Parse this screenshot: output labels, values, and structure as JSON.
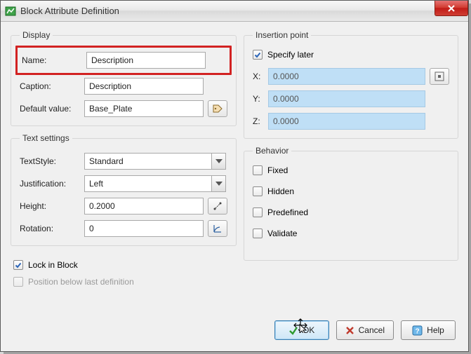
{
  "window": {
    "title": "Block Attribute Definition"
  },
  "display": {
    "legend": "Display",
    "name_label": "Name:",
    "name_value": "Description",
    "caption_label": "Caption:",
    "caption_value": "Description",
    "default_label": "Default value:",
    "default_value": "Base_Plate"
  },
  "text_settings": {
    "legend": "Text settings",
    "textstyle_label": "TextStyle:",
    "textstyle_value": "Standard",
    "justification_label": "Justification:",
    "justification_value": "Left",
    "height_label": "Height:",
    "height_value": "0.2000",
    "rotation_label": "Rotation:",
    "rotation_value": "0"
  },
  "insertion": {
    "legend": "Insertion point",
    "specify_label": "Specify later",
    "x_label": "X:",
    "x_value": "0.0000",
    "y_label": "Y:",
    "y_value": "0.0000",
    "z_label": "Z:",
    "z_value": "0.0000"
  },
  "behavior": {
    "legend": "Behavior",
    "fixed_label": "Fixed",
    "hidden_label": "Hidden",
    "predefined_label": "Predefined",
    "validate_label": "Validate"
  },
  "lock": {
    "lock_label": "Lock in Block",
    "position_label": "Position below last definition"
  },
  "buttons": {
    "ok": "OK",
    "cancel": "Cancel",
    "help": "Help"
  }
}
